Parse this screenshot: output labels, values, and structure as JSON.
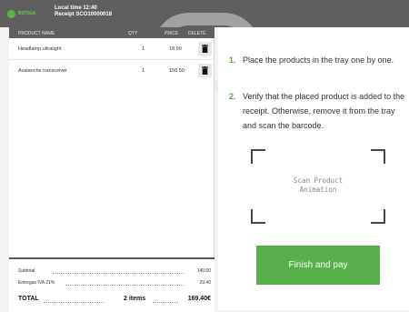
{
  "header": {
    "logo_text": "BOTIGA",
    "local_time": "Local time 12:40",
    "receipt": "Receipt SCO10000018"
  },
  "columns": {
    "product_name": "PRODUCT NAME",
    "qty": "QTY",
    "price": "PRICE",
    "delete": "DELETE"
  },
  "items": [
    {
      "name": "Headlamp ultralight",
      "qty": "1",
      "price": "18.90"
    },
    {
      "name": "Avalanche transceiver",
      "qty": "1",
      "price": "150.50"
    }
  ],
  "summary": {
    "subtotal_label": "Subtotal",
    "subtotal_value": "140.00",
    "tax_label": "Entregas IVA 21%",
    "tax_value": "29.40",
    "total_label": "TOTAL",
    "total_count": "2 items",
    "total_value": "169.40€"
  },
  "instructions": [
    {
      "num": "1.",
      "text": "Place the products in the tray one by one."
    },
    {
      "num": "2.",
      "text": "Verify that the placed product is added to the receipt. Otherwise, remove it from the tray and scan the barcode."
    }
  ],
  "scan": {
    "line1": "Scan Product",
    "line2": "Animation"
  },
  "finish_button": "Finish and pay",
  "colors": {
    "accent_green": "#57b04a",
    "header_gray": "#5f5f5f"
  }
}
